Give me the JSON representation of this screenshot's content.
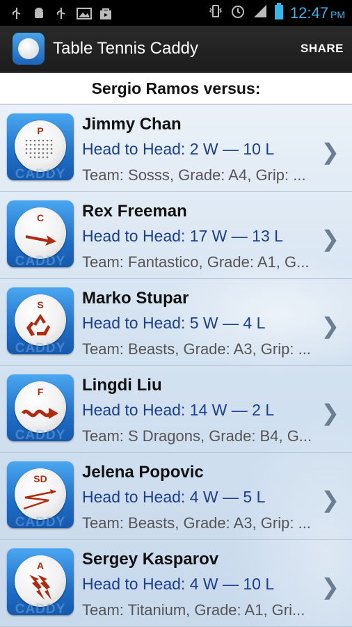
{
  "status_bar": {
    "time": "12:47",
    "ampm": "PM"
  },
  "action_bar": {
    "title": "Table Tennis Caddy",
    "share_label": "SHARE"
  },
  "header": {
    "title": "Sergio Ramos versus:"
  },
  "opponents": [
    {
      "name": "Jimmy Chan",
      "h2h": "Head to Head: 2 W — 10 L",
      "team": "Team: Sosss, Grade: A4, Grip: ...",
      "code": "P",
      "icon": "pimples-icon"
    },
    {
      "name": "Rex Freeman",
      "h2h": "Head to Head: 17 W — 13 L",
      "team": "Team: Fantastico, Grade: A1, G...",
      "code": "C",
      "icon": "arrow-icon"
    },
    {
      "name": "Marko Stupar",
      "h2h": "Head to Head: 5 W — 4 L",
      "team": "Team: Beasts, Grade: A3, Grip: ...",
      "code": "S",
      "icon": "recycle-icon"
    },
    {
      "name": "Lingdi Liu",
      "h2h": "Head to Head: 14 W — 2 L",
      "team": "Team: S Dragons, Grade: B4, G...",
      "code": "F",
      "icon": "wave-arrow-icon"
    },
    {
      "name": "Jelena Popovic",
      "h2h": "Head to Head: 4 W — 5 L",
      "team": "Team: Beasts, Grade: A3, Grip: ...",
      "code": "SD",
      "icon": "zigzag-icon"
    },
    {
      "name": "Sergey Kasparov",
      "h2h": "Head to Head: 4 W — 10 L",
      "team": "Team: Titanium, Grade: A1, Gri...",
      "code": "A",
      "icon": "lightning-icon"
    }
  ],
  "tile_watermark": "CADDY",
  "colors": {
    "accent": "#33b5e5",
    "tile_blue": "#1e6fc9",
    "icon_red": "#b02a10"
  }
}
